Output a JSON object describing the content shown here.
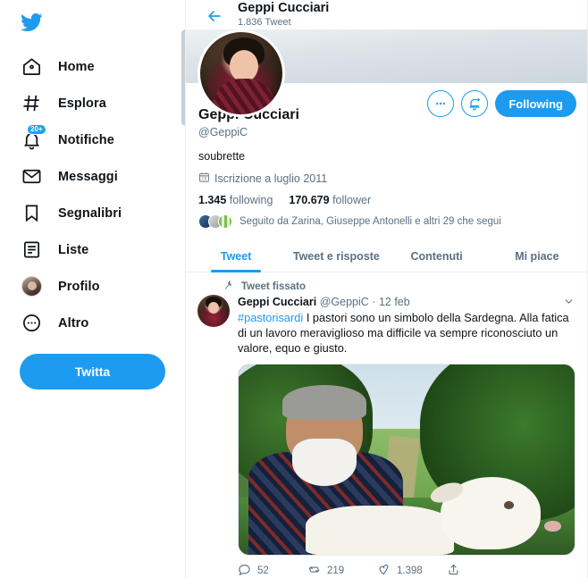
{
  "sidebar": {
    "logo_icon": "twitter-bird-icon",
    "items": [
      {
        "label": "Home",
        "icon": "home-icon"
      },
      {
        "label": "Esplora",
        "icon": "hashtag-icon"
      },
      {
        "label": "Notifiche",
        "icon": "bell-icon",
        "badge": "20+"
      },
      {
        "label": "Messaggi",
        "icon": "envelope-icon"
      },
      {
        "label": "Segnalibri",
        "icon": "bookmark-icon"
      },
      {
        "label": "Liste",
        "icon": "list-icon"
      },
      {
        "label": "Profilo",
        "icon": "avatar-icon"
      },
      {
        "label": "Altro",
        "icon": "more-circle-icon"
      }
    ],
    "compose_label": "Twitta"
  },
  "topbar": {
    "back_icon": "back-arrow-icon",
    "name": "Geppi Cucciari",
    "tweet_count": "1.836 Tweet"
  },
  "profile": {
    "name": "Geppi Cucciari",
    "handle": "@GeppiC",
    "bio": "soubrette",
    "joined_icon": "calendar-icon",
    "joined": "Iscrizione a luglio 2011",
    "following_count": "1.345",
    "following_label": "following",
    "followers_count": "170.679",
    "followers_label": "follower",
    "followed_by": "Seguito da Zarina, Giuseppe Antonelli e altri 29 che segui",
    "more_icon": "more-options-icon",
    "notify_icon": "bell-plus-icon",
    "follow_button": "Following"
  },
  "tabs": [
    {
      "label": "Tweet",
      "active": true
    },
    {
      "label": "Tweet e risposte",
      "active": false
    },
    {
      "label": "Contenuti",
      "active": false
    },
    {
      "label": "Mi piace",
      "active": false
    }
  ],
  "tweet": {
    "pinned_icon": "pin-icon",
    "pinned_label": "Tweet fissato",
    "author": "Geppi Cucciari",
    "handle": "@GeppiC",
    "separator": "·",
    "date": "12 feb",
    "caret_icon": "chevron-down-icon",
    "hashtag": "#pastorisardi",
    "text": " I pastori sono un simbolo della Sardegna. Alla fatica di un lavoro meraviglioso ma difficile va sempre riconosciuto un valore, equo e giusto.",
    "media_alt": "shepherd-holding-sheep-photo",
    "actions": {
      "reply_icon": "reply-icon",
      "reply_count": "52",
      "retweet_icon": "retweet-icon",
      "retweet_count": "219",
      "like_icon": "heart-icon",
      "like_count": "1.398",
      "share_icon": "share-icon",
      "share_count": ""
    }
  },
  "colors": {
    "accent": "#1d9bf0",
    "text": "#0f1419",
    "muted": "#5b7083",
    "border": "#ebeef0"
  }
}
